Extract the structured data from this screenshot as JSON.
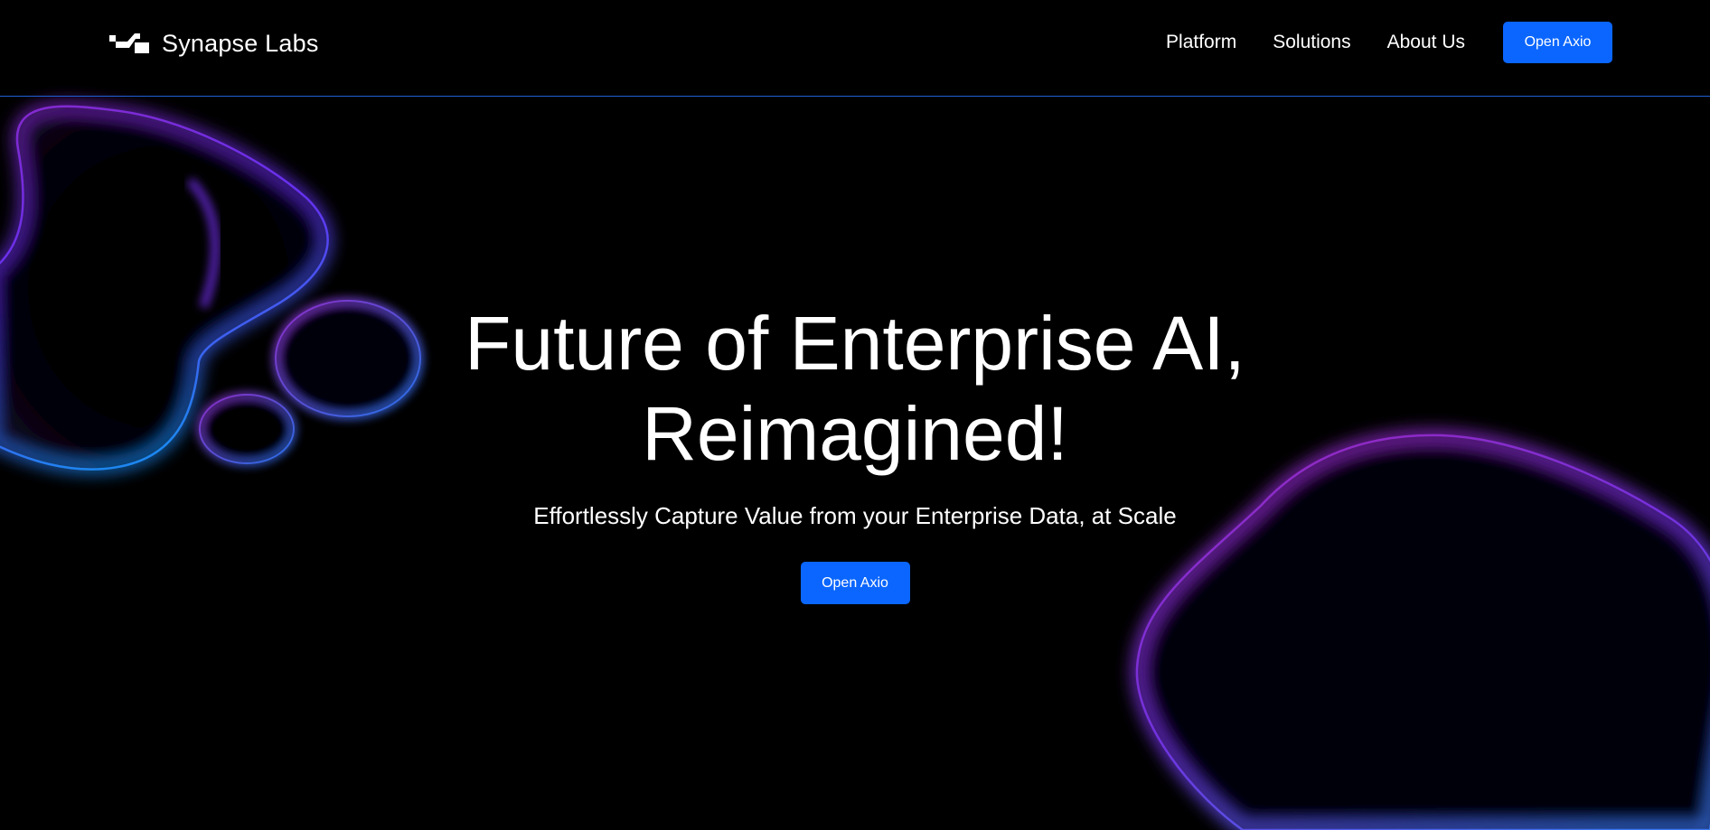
{
  "brand": {
    "name": "Synapse Labs",
    "logo_icon": "synapse-logo-icon"
  },
  "nav": {
    "links": [
      {
        "label": "Platform"
      },
      {
        "label": "Solutions"
      },
      {
        "label": "About Us"
      }
    ],
    "cta_label": "Open Axio"
  },
  "hero": {
    "title_line1": "Future of Enterprise AI,",
    "title_line2": "Reimagined!",
    "subtitle": "Effortlessly Capture Value from your Enterprise Data, at Scale",
    "cta_label": "Open Axio"
  },
  "colors": {
    "background": "#000000",
    "accent": "#0a66ff",
    "header_border": "#1f5fd6",
    "blob_purple": "#8a2be2",
    "blob_blue": "#3a7bff"
  }
}
